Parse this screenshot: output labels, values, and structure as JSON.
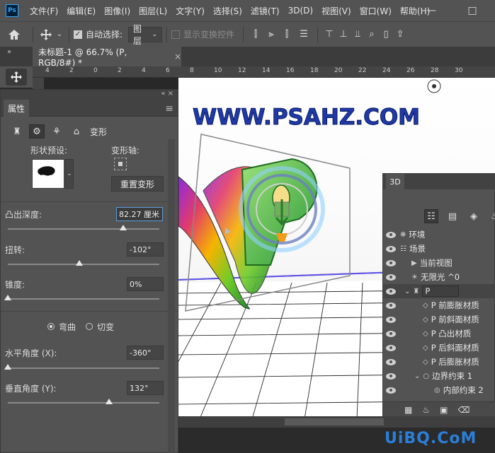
{
  "menubar": {
    "logo": "Ps",
    "items": [
      "文件(F)",
      "编辑(E)",
      "图像(I)",
      "图层(L)",
      "文字(Y)",
      "选择(S)",
      "滤镜(T)",
      "3D(D)",
      "视图(V)",
      "窗口(W)",
      "帮助(H)"
    ],
    "win_controls": [
      "—",
      "□"
    ]
  },
  "options": {
    "auto_select_label": "自动选择:",
    "auto_select_target": "图层",
    "show_transform_label": "显示变换控件"
  },
  "document": {
    "tab_title": "未标题-1 @ 66.7% (P, RGB/8#) *",
    "tab_close": "×",
    "panel_toggle": "»"
  },
  "rulers": {
    "h_ticks": [
      "4",
      "2",
      "0",
      "2",
      "4",
      "6",
      "8",
      "10",
      "12",
      "14",
      "16",
      "18",
      "20",
      "22",
      "24",
      "26",
      "28",
      "30"
    ],
    "corner": "0"
  },
  "canvas": {
    "heading": "WWW.PSAHZ.COM"
  },
  "properties": {
    "top_controls": "«  ×",
    "title": "属性",
    "tab_label": "变形",
    "shape_preset_label": "形状预设:",
    "transform_axis_label": "变形轴:",
    "reset_label": "重置变形",
    "extrude_depth_label": "凸出深度:",
    "extrude_depth_value": "82.27 厘米",
    "extrude_depth_level": 0.76,
    "twist_label": "扭转:",
    "twist_value": "-102°",
    "twist_level": 0.47,
    "taper_label": "锥度:",
    "taper_value": "0%",
    "taper_level": 0.0,
    "bend_label": "弯曲",
    "shear_label": "切变",
    "horizontal_angle_label": "水平角度 (X):",
    "horizontal_angle_value": "-360°",
    "horizontal_angle_level": 0.0,
    "vertical_angle_label": "垂直角度 (Y):",
    "vertical_angle_value": "132°",
    "vertical_angle_level": 0.67
  },
  "panel3d": {
    "title": "3D",
    "items": [
      {
        "label": "环境",
        "indent": 0,
        "icon": "❋"
      },
      {
        "label": "场景",
        "indent": 0,
        "icon": "☷"
      },
      {
        "label": "当前视图",
        "indent": 1,
        "icon": "▶"
      },
      {
        "label": "无限光 ^0",
        "indent": 1,
        "icon": "☀"
      },
      {
        "label": "P",
        "indent": 1,
        "icon": "⌄",
        "selected": true
      },
      {
        "label": "P 前膨胀材质",
        "indent": 2,
        "icon": "◇"
      },
      {
        "label": "P 前斜面材质",
        "indent": 2,
        "icon": "◇"
      },
      {
        "label": "P 凸出材质",
        "indent": 2,
        "icon": "◇"
      },
      {
        "label": "P 后斜面材质",
        "indent": 2,
        "icon": "◇"
      },
      {
        "label": "P 后膨胀材质",
        "indent": 2,
        "icon": "◇"
      },
      {
        "label": "边界约束 1",
        "indent": 2,
        "icon": "○"
      },
      {
        "label": "内部约束 2",
        "indent": 3,
        "icon": "◎"
      }
    ]
  },
  "watermark": "UiBQ.CoM"
}
